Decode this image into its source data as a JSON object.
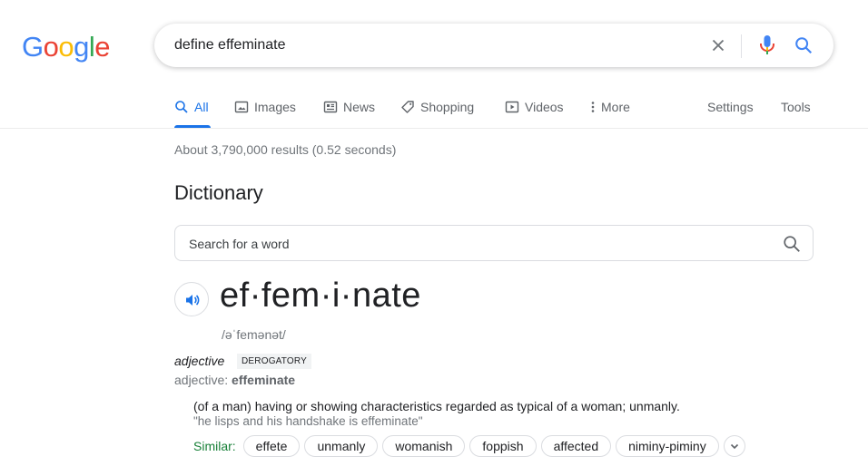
{
  "logo": {
    "letters": [
      "G",
      "o",
      "o",
      "g",
      "l",
      "e"
    ],
    "colors": [
      "#4285F4",
      "#EA4335",
      "#FBBC05",
      "#4285F4",
      "#34A853",
      "#EA4335"
    ]
  },
  "search": {
    "query": "define effeminate"
  },
  "tabs": [
    {
      "label": "All",
      "icon": "search-icon",
      "active": true
    },
    {
      "label": "Images",
      "icon": "image-icon"
    },
    {
      "label": "News",
      "icon": "news-icon"
    },
    {
      "label": "Shopping",
      "icon": "tag-icon"
    },
    {
      "label": "Videos",
      "icon": "play-icon"
    },
    {
      "label": "More",
      "icon": "more-vert-icon"
    }
  ],
  "tools": {
    "settings": "Settings",
    "tools": "Tools"
  },
  "result_stats": "About 3,790,000 results (0.52 seconds)",
  "dictionary": {
    "title": "Dictionary",
    "search_placeholder": "Search for a word",
    "headword": "ef·fem·i·nate",
    "phonetic": "/əˈfemənət/",
    "part_of_speech": "adjective",
    "register": "DEROGATORY",
    "pos_prefix": "adjective: ",
    "pos_word": "effeminate",
    "definition": "(of a man) having or showing characteristics regarded as typical of a woman; unmanly.",
    "example": "\"he lisps and his handshake is effeminate\"",
    "similar_label": "Similar:",
    "similar": [
      "effete",
      "unmanly",
      "womanish",
      "foppish",
      "affected",
      "niminy-piminy"
    ]
  },
  "colors": {
    "accent": "#1a73e8",
    "similar_label": "#188038"
  }
}
